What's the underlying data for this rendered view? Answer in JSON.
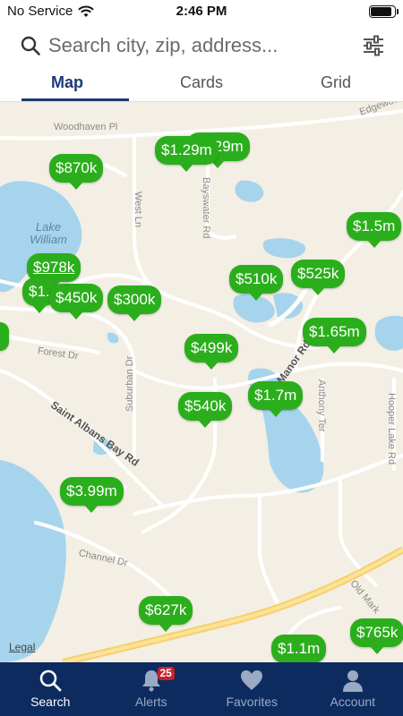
{
  "status_bar": {
    "carrier": "No Service",
    "time": "2:46 PM",
    "battery_level": 0.9
  },
  "search": {
    "placeholder": "Search city, zip, address..."
  },
  "tabs": [
    {
      "label": "Map",
      "active": true
    },
    {
      "label": "Cards",
      "active": false
    },
    {
      "label": "Grid",
      "active": false
    }
  ],
  "map": {
    "streets": [
      "Woodhaven Pl",
      "Edgewood",
      "Bayswater Rd",
      "West Ln",
      "Forest Dr",
      "Suburban Dr",
      "Saint Albans Bay Rd",
      "Manor Rd",
      "Anthony Ter",
      "Hooper Lake Rd",
      "Channel Dr",
      "Old Mark"
    ],
    "lake_label": "Lake William",
    "legal": "Legal",
    "pins": [
      "$870k",
      "$1.29m",
      "$1.29m",
      "$1.5m",
      "$978k",
      "$1.",
      "$450k",
      "$300k",
      "$510k",
      "$525k",
      "$1.65m",
      "$499k",
      "$540k",
      "$1.7m",
      "$3.99m",
      "$627k",
      "$1.1m",
      "$765k"
    ]
  },
  "bottom_nav": [
    {
      "label": "Search",
      "icon": "search-icon",
      "active": true
    },
    {
      "label": "Alerts",
      "icon": "bell-icon",
      "badge": "25",
      "active": false
    },
    {
      "label": "Favorites",
      "icon": "heart-icon",
      "active": false
    },
    {
      "label": "Account",
      "icon": "person-icon",
      "active": false
    }
  ],
  "colors": {
    "pin": "#2bae1c",
    "nav_bg": "#0d2b5f",
    "tab_active": "#1b3a75",
    "water": "#a6d4ec",
    "badge": "#c8202d"
  }
}
